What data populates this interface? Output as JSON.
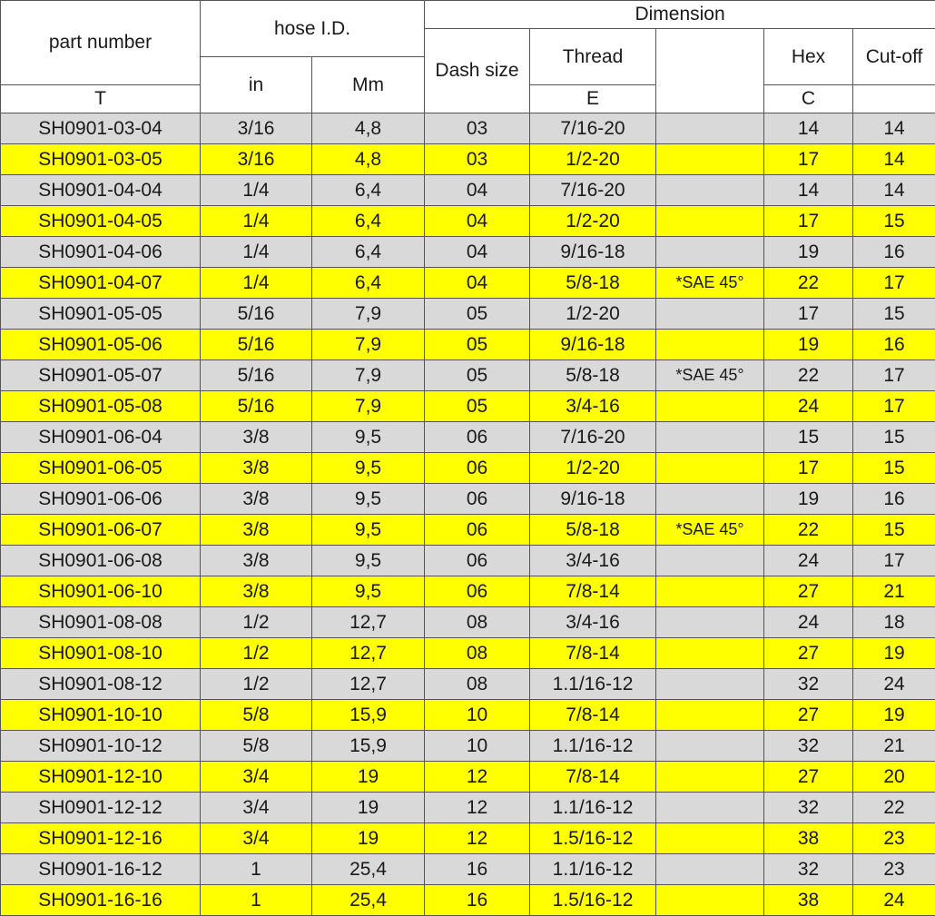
{
  "headers": {
    "part_number": "part number",
    "hose_id": "hose I.D.",
    "in": "in",
    "mm": "Mm",
    "dimension": "Dimension",
    "dash_size": "Dash size",
    "thread": "Thread",
    "thread_sub": "T",
    "hex": "Hex",
    "hex_sub": "E",
    "cutoff": "Cut-off",
    "cutoff_sub": "C"
  },
  "row_colors": {
    "gray": "#d9d9d9",
    "yellow": "#ffff00"
  },
  "rows": [
    {
      "part": "SH0901-03-04",
      "in": "3/16",
      "mm": "4,8",
      "dash": "03",
      "thread": "7/16-20",
      "note": "",
      "hex": "14",
      "cut": "14"
    },
    {
      "part": "SH0901-03-05",
      "in": "3/16",
      "mm": "4,8",
      "dash": "03",
      "thread": "1/2-20",
      "note": "",
      "hex": "17",
      "cut": "14"
    },
    {
      "part": "SH0901-04-04",
      "in": "1/4",
      "mm": "6,4",
      "dash": "04",
      "thread": "7/16-20",
      "note": "",
      "hex": "14",
      "cut": "14"
    },
    {
      "part": "SH0901-04-05",
      "in": "1/4",
      "mm": "6,4",
      "dash": "04",
      "thread": "1/2-20",
      "note": "",
      "hex": "17",
      "cut": "15"
    },
    {
      "part": "SH0901-04-06",
      "in": "1/4",
      "mm": "6,4",
      "dash": "04",
      "thread": "9/16-18",
      "note": "",
      "hex": "19",
      "cut": "16"
    },
    {
      "part": "SH0901-04-07",
      "in": "1/4",
      "mm": "6,4",
      "dash": "04",
      "thread": "5/8-18",
      "note": "*SAE 45°",
      "hex": "22",
      "cut": "17"
    },
    {
      "part": "SH0901-05-05",
      "in": "5/16",
      "mm": "7,9",
      "dash": "05",
      "thread": "1/2-20",
      "note": "",
      "hex": "17",
      "cut": "15"
    },
    {
      "part": "SH0901-05-06",
      "in": "5/16",
      "mm": "7,9",
      "dash": "05",
      "thread": "9/16-18",
      "note": "",
      "hex": "19",
      "cut": "16"
    },
    {
      "part": "SH0901-05-07",
      "in": "5/16",
      "mm": "7,9",
      "dash": "05",
      "thread": "5/8-18",
      "note": "*SAE 45°",
      "hex": "22",
      "cut": "17"
    },
    {
      "part": "SH0901-05-08",
      "in": "5/16",
      "mm": "7,9",
      "dash": "05",
      "thread": "3/4-16",
      "note": "",
      "hex": "24",
      "cut": "17"
    },
    {
      "part": "SH0901-06-04",
      "in": "3/8",
      "mm": "9,5",
      "dash": "06",
      "thread": "7/16-20",
      "note": "",
      "hex": "15",
      "cut": "15"
    },
    {
      "part": "SH0901-06-05",
      "in": "3/8",
      "mm": "9,5",
      "dash": "06",
      "thread": "1/2-20",
      "note": "",
      "hex": "17",
      "cut": "15"
    },
    {
      "part": "SH0901-06-06",
      "in": "3/8",
      "mm": "9,5",
      "dash": "06",
      "thread": "9/16-18",
      "note": "",
      "hex": "19",
      "cut": "16"
    },
    {
      "part": "SH0901-06-07",
      "in": "3/8",
      "mm": "9,5",
      "dash": "06",
      "thread": "5/8-18",
      "note": "*SAE 45°",
      "hex": "22",
      "cut": "15"
    },
    {
      "part": "SH0901-06-08",
      "in": "3/8",
      "mm": "9,5",
      "dash": "06",
      "thread": "3/4-16",
      "note": "",
      "hex": "24",
      "cut": "17"
    },
    {
      "part": "SH0901-06-10",
      "in": "3/8",
      "mm": "9,5",
      "dash": "06",
      "thread": "7/8-14",
      "note": "",
      "hex": "27",
      "cut": "21"
    },
    {
      "part": "SH0901-08-08",
      "in": "1/2",
      "mm": "12,7",
      "dash": "08",
      "thread": "3/4-16",
      "note": "",
      "hex": "24",
      "cut": "18"
    },
    {
      "part": "SH0901-08-10",
      "in": "1/2",
      "mm": "12,7",
      "dash": "08",
      "thread": "7/8-14",
      "note": "",
      "hex": "27",
      "cut": "19"
    },
    {
      "part": "SH0901-08-12",
      "in": "1/2",
      "mm": "12,7",
      "dash": "08",
      "thread": "1.1/16-12",
      "note": "",
      "hex": "32",
      "cut": "24"
    },
    {
      "part": "SH0901-10-10",
      "in": "5/8",
      "mm": "15,9",
      "dash": "10",
      "thread": "7/8-14",
      "note": "",
      "hex": "27",
      "cut": "19"
    },
    {
      "part": "SH0901-10-12",
      "in": "5/8",
      "mm": "15,9",
      "dash": "10",
      "thread": "1.1/16-12",
      "note": "",
      "hex": "32",
      "cut": "21"
    },
    {
      "part": "SH0901-12-10",
      "in": "3/4",
      "mm": "19",
      "dash": "12",
      "thread": "7/8-14",
      "note": "",
      "hex": "27",
      "cut": "20"
    },
    {
      "part": "SH0901-12-12",
      "in": "3/4",
      "mm": "19",
      "dash": "12",
      "thread": "1.1/16-12",
      "note": "",
      "hex": "32",
      "cut": "22"
    },
    {
      "part": "SH0901-12-16",
      "in": "3/4",
      "mm": "19",
      "dash": "12",
      "thread": "1.5/16-12",
      "note": "",
      "hex": "38",
      "cut": "23"
    },
    {
      "part": "SH0901-16-12",
      "in": "1",
      "mm": "25,4",
      "dash": "16",
      "thread": "1.1/16-12",
      "note": "",
      "hex": "32",
      "cut": "23"
    },
    {
      "part": "SH0901-16-16",
      "in": "1",
      "mm": "25,4",
      "dash": "16",
      "thread": "1.5/16-12",
      "note": "",
      "hex": "38",
      "cut": "24"
    }
  ]
}
